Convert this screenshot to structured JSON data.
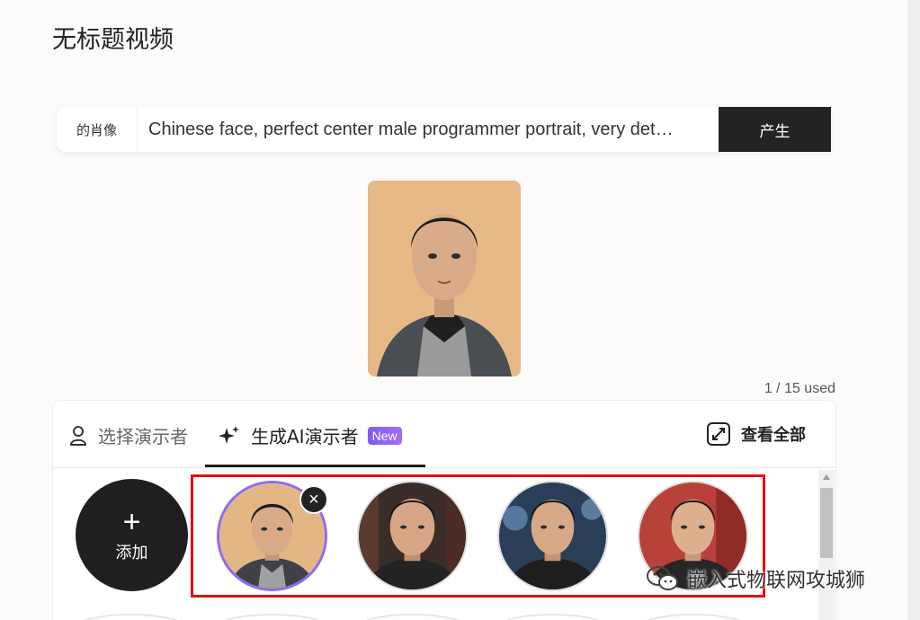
{
  "page": {
    "title": "无标题视频"
  },
  "prompt": {
    "label": "的肖像",
    "value": "Chinese face, perfect center male programmer portrait, very det…",
    "generate_label": "产生"
  },
  "usage": "1 / 15 used",
  "tabs": [
    {
      "label": "选择演示者",
      "icon": "person-icon",
      "active": false
    },
    {
      "label": "生成AI演示者",
      "icon": "sparkle-icon",
      "active": true,
      "badge": "New"
    }
  ],
  "view_all_label": "查看全部",
  "add_button": {
    "symbol": "+",
    "label": "添加"
  },
  "avatars": [
    {
      "selected": true,
      "background": "#e3b684"
    },
    {
      "selected": false,
      "background": "#3a2c28"
    },
    {
      "selected": false,
      "background": "#2b3e57"
    },
    {
      "selected": false,
      "background": "#b8423a"
    }
  ],
  "remove_symbol": "×",
  "watermark": "嵌入式物联网攻城狮",
  "colors": {
    "accent": "#8c6bf0",
    "highlight": "#e01010",
    "dark": "#232323"
  }
}
